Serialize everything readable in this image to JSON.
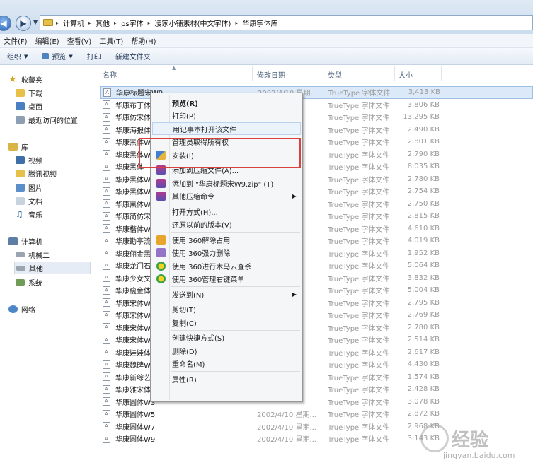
{
  "address_bar": {
    "crumbs": [
      "计算机",
      "其他",
      "ps字体",
      "凌家小铺素材(中文字体)",
      "华康字体库"
    ]
  },
  "menubar": [
    "文件(F)",
    "编辑(E)",
    "查看(V)",
    "工具(T)",
    "帮助(H)"
  ],
  "toolbar": {
    "organize": "组织",
    "preview": "预览",
    "print": "打印",
    "new_folder": "新建文件夹"
  },
  "nav": {
    "favorites": "收藏夹",
    "downloads": "下载",
    "desktop": "桌面",
    "recent": "最近访问的位置",
    "libraries": "库",
    "videos": "视频",
    "tencent_video": "腾讯视频",
    "pictures": "图片",
    "documents": "文档",
    "music": "音乐",
    "computer": "计算机",
    "disk1": "机械二",
    "disk2": "其他",
    "disk3": "系统",
    "network": "网络"
  },
  "columns": {
    "name": "名称",
    "date": "修改日期",
    "type": "类型",
    "size": "大小"
  },
  "files": [
    {
      "name": "华康标题宋W9",
      "date": "2002/4/10 星期...",
      "type": "TrueType 字体文件",
      "size": "3,413 KB"
    },
    {
      "name": "华康布丁体",
      "date": "",
      "type": "TrueType 字体文件",
      "size": "3,806 KB"
    },
    {
      "name": "华康仿宋体",
      "date": "四 ...",
      "type": "TrueType 字体文件",
      "size": "13,295 KB"
    },
    {
      "name": "华康海报体",
      "date": "",
      "type": "TrueType 字体文件",
      "size": "2,490 KB"
    },
    {
      "name": "华康黑体W",
      "date": "",
      "type": "TrueType 字体文件",
      "size": "2,801 KB"
    },
    {
      "name": "华康黑体W",
      "date": "",
      "type": "TrueType 字体文件",
      "size": "2,790 KB"
    },
    {
      "name": "华康黑体",
      "date": "",
      "type": "TrueType 字体文件",
      "size": "8,035 KB"
    },
    {
      "name": "华康黑体W",
      "date": "",
      "type": "TrueType 字体文件",
      "size": "2,780 KB"
    },
    {
      "name": "华康黑体W",
      "date": "",
      "type": "TrueType 字体文件",
      "size": "2,754 KB"
    },
    {
      "name": "华康黑体W",
      "date": "",
      "type": "TrueType 字体文件",
      "size": "2,750 KB"
    },
    {
      "name": "华康简仿宋",
      "date": "",
      "type": "TrueType 字体文件",
      "size": "2,815 KB"
    },
    {
      "name": "华康楷体W",
      "date": "",
      "type": "TrueType 字体文件",
      "size": "4,610 KB"
    },
    {
      "name": "华康勘亭流",
      "date": "",
      "type": "TrueType 字体文件",
      "size": "4,019 KB"
    },
    {
      "name": "华康俪金黑",
      "date": "",
      "type": "TrueType 字体文件",
      "size": "1,952 KB"
    },
    {
      "name": "华康龙门石",
      "date": "",
      "type": "TrueType 字体文件",
      "size": "5,064 KB"
    },
    {
      "name": "华康少女文",
      "date": "",
      "type": "TrueType 字体文件",
      "size": "3,832 KB"
    },
    {
      "name": "华康瘦金体",
      "date": "",
      "type": "TrueType 字体文件",
      "size": "5,004 KB"
    },
    {
      "name": "华康宋体W",
      "date": "",
      "type": "TrueType 字体文件",
      "size": "2,795 KB"
    },
    {
      "name": "华康宋体W",
      "date": "",
      "type": "TrueType 字体文件",
      "size": "2,769 KB"
    },
    {
      "name": "华康宋体W",
      "date": "",
      "type": "TrueType 字体文件",
      "size": "2,780 KB"
    },
    {
      "name": "华康宋体W",
      "date": "",
      "type": "TrueType 字体文件",
      "size": "2,514 KB"
    },
    {
      "name": "华康娃娃体",
      "date": "",
      "type": "TrueType 字体文件",
      "size": "2,617 KB"
    },
    {
      "name": "华康魏碑W",
      "date": "",
      "type": "TrueType 字体文件",
      "size": "4,430 KB"
    },
    {
      "name": "华康新综艺",
      "date": "",
      "type": "TrueType 字体文件",
      "size": "1,574 KB"
    },
    {
      "name": "华康雅宋体",
      "date": "",
      "type": "TrueType 字体文件",
      "size": "2,428 KB"
    },
    {
      "name": "华康圆体W3",
      "date": "",
      "type": "TrueType 字体文件",
      "size": "3,078 KB"
    },
    {
      "name": "华康圆体W5",
      "date": "2002/4/10 星期...",
      "type": "TrueType 字体文件",
      "size": "2,872 KB"
    },
    {
      "name": "华康圆体W7",
      "date": "2002/4/10 星期...",
      "type": "TrueType 字体文件",
      "size": "2,968 KB"
    },
    {
      "name": "华康圆体W9",
      "date": "2002/4/10 星期...",
      "type": "TrueType 字体文件",
      "size": "3,143 KB"
    }
  ],
  "context_menu": [
    {
      "label": "预览(R)",
      "bold": true
    },
    {
      "label": "打印(P)"
    },
    {
      "label": "用记事本打开该文件",
      "highlight": true
    },
    {
      "label": "管理员取得所有权"
    },
    {
      "label": "安装(I)",
      "icon": "shield-icon"
    },
    {
      "sep": true
    },
    {
      "label": "添加到压缩文件(A)...",
      "icon": "archive-icon"
    },
    {
      "label": "添加到 \"华康标题宋W9.zip\" (T)",
      "icon": "archive-icon"
    },
    {
      "label": "其他压缩命令",
      "icon": "archive-icon",
      "submenu": true
    },
    {
      "sep": true
    },
    {
      "label": "打开方式(H)..."
    },
    {
      "label": "还原以前的版本(V)"
    },
    {
      "sep": true
    },
    {
      "label": "使用 360解除占用",
      "icon": "unlock-360-icon"
    },
    {
      "label": "使用 360强力删除",
      "icon": "delete-360-icon"
    },
    {
      "label": "使用 360进行木马云查杀",
      "icon": "scan-360-icon"
    },
    {
      "label": "使用 360管理右键菜单",
      "icon": "manage-360-icon"
    },
    {
      "sep": true
    },
    {
      "label": "发送到(N)",
      "submenu": true
    },
    {
      "sep": true
    },
    {
      "label": "剪切(T)"
    },
    {
      "label": "复制(C)"
    },
    {
      "sep": true
    },
    {
      "label": "创建快捷方式(S)"
    },
    {
      "label": "删除(D)"
    },
    {
      "label": "重命名(M)"
    },
    {
      "sep": true
    },
    {
      "label": "属性(R)"
    }
  ],
  "watermark": {
    "text": "经验",
    "sub": "jingyan.baidu.com"
  },
  "colors": {
    "highlight_box": "#d9403e",
    "selection": "#dbe9f9"
  }
}
